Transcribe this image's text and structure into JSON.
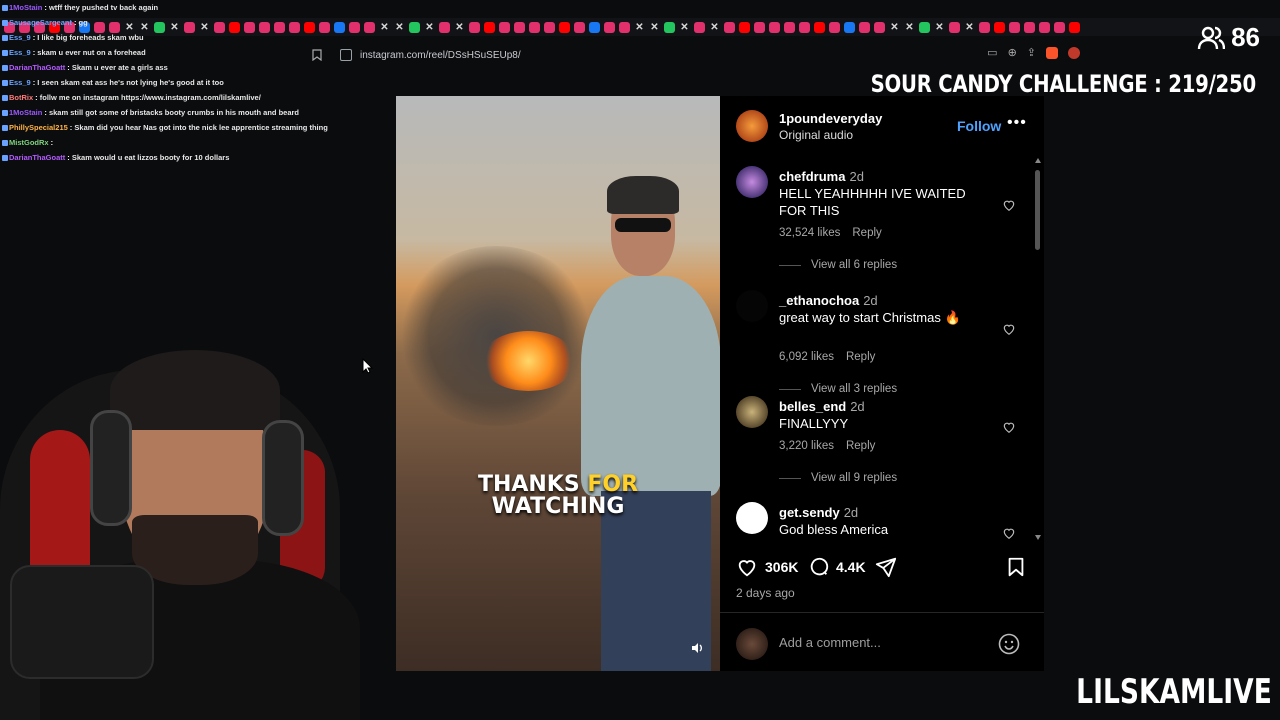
{
  "chat": [
    {
      "user": "1MoStain",
      "color": "#9b59ff",
      "text": "wtff they pushed tv back again"
    },
    {
      "user": "SausageSargeant",
      "color": "#6aa3ff",
      "text": "gg"
    },
    {
      "user": "Ess_9",
      "color": "#6aa3ff",
      "text": "I like big foreheads skam wbu"
    },
    {
      "user": "Ess_9",
      "color": "#6aa3ff",
      "text": "skam u ever nut on a forehead"
    },
    {
      "user": "DarianThaGoatt",
      "color": "#b45cff",
      "text": "Skam u ever ate a girls ass"
    },
    {
      "user": "Ess_9",
      "color": "#6aa3ff",
      "text": "I seen skam eat ass he's not lying he's good at it too"
    },
    {
      "user": "BotRix",
      "color": "#ff7a7a",
      "text": "follw me on instagram https://www.instagram.com/lilskamlive/"
    },
    {
      "user": "1MoStain",
      "color": "#9b59ff",
      "text": "skam still got some of bristacks booty crumbs in his mouth and beard"
    },
    {
      "user": "PhillySpecial215",
      "color": "#ffb347",
      "text": "Skam did you hear Nas got into the nick lee apprentice streaming thing"
    },
    {
      "user": "MistGodRx",
      "color": "#7fd37f",
      "text": ""
    },
    {
      "user": "DarianThaGoatt",
      "color": "#b45cff",
      "text": "Skam would u eat lizzos booty for 10 dollars"
    }
  ],
  "address_bar": {
    "url": "instagram.com/reel/DSsHSuSEUp8/"
  },
  "overlay": {
    "viewer_count": "86",
    "challenge": "SOUR CANDY CHALLENGE : 219/250",
    "brand": "LILSKAMLIVE"
  },
  "video": {
    "caption_white": "THANKS ",
    "caption_highlight": "FOR",
    "caption_line2": "WATCHING"
  },
  "post": {
    "username": "1poundeveryday",
    "audio": "Original audio",
    "follow_label": "Follow",
    "more_label": "•••",
    "likes": "306K",
    "comments_count": "4.4K",
    "posted": "2 days ago",
    "add_comment_placeholder": "Add a comment..."
  },
  "comments": [
    {
      "user": "chefdruma",
      "time": "2d",
      "text": "HELL YEAHHHHH IVE WAITED FOR THIS",
      "likes": "32,524 likes",
      "reply": "Reply",
      "view_replies": "View all 6 replies"
    },
    {
      "user": "_ethanochoa",
      "time": "2d",
      "text": "great way to start Christmas 🔥",
      "likes": "6,092 likes",
      "reply": "Reply",
      "view_replies": "View all 3 replies"
    },
    {
      "user": "belles_end",
      "time": "2d",
      "text": "FINALLYYY",
      "likes": "3,220 likes",
      "reply": "Reply",
      "view_replies": "View all 9 replies"
    },
    {
      "user": "get.sendy",
      "time": "2d",
      "text": "God bless America",
      "likes": "",
      "reply": "",
      "view_replies": ""
    }
  ],
  "colors": {
    "accent": "#4da3ff",
    "challenge_text": "#ffffff"
  }
}
